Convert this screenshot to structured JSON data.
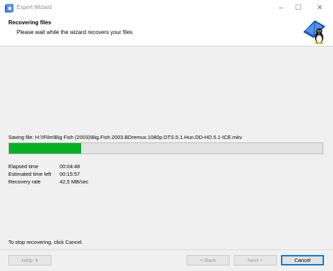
{
  "window": {
    "title": "Export Wizard",
    "icon": "wizard-app-icon",
    "controls": {
      "minimize": "–",
      "maximize": "☐",
      "close": "✕"
    }
  },
  "header": {
    "title": "Recovering files",
    "subtitle": "Please wait while the wizard recovers your files",
    "logo_icon": "penguin-book-icon"
  },
  "progress": {
    "status_text": "Saving file: H:\\!Film\\Big Fish (2003)\\Big.Fish.2003.BDremux.1080p.DTS.5.1.Hun.DD-HD.5.1-ICE.mkv",
    "fraction_complete": 0.23,
    "fill_color": "#06b025"
  },
  "stats": [
    {
      "label": "Elapsed time",
      "value": "00:04:48"
    },
    {
      "label": "Estimated time left",
      "value": "00:15:57"
    },
    {
      "label": "Recovery rate",
      "value": "42,5 MB/sec"
    }
  ],
  "footer": {
    "hint": "To stop recovering, click Cancel.",
    "help_label": "Help",
    "help_arrow": "▾",
    "back_label": "< Back",
    "next_label": "Next >",
    "cancel_label": "Cancel"
  }
}
